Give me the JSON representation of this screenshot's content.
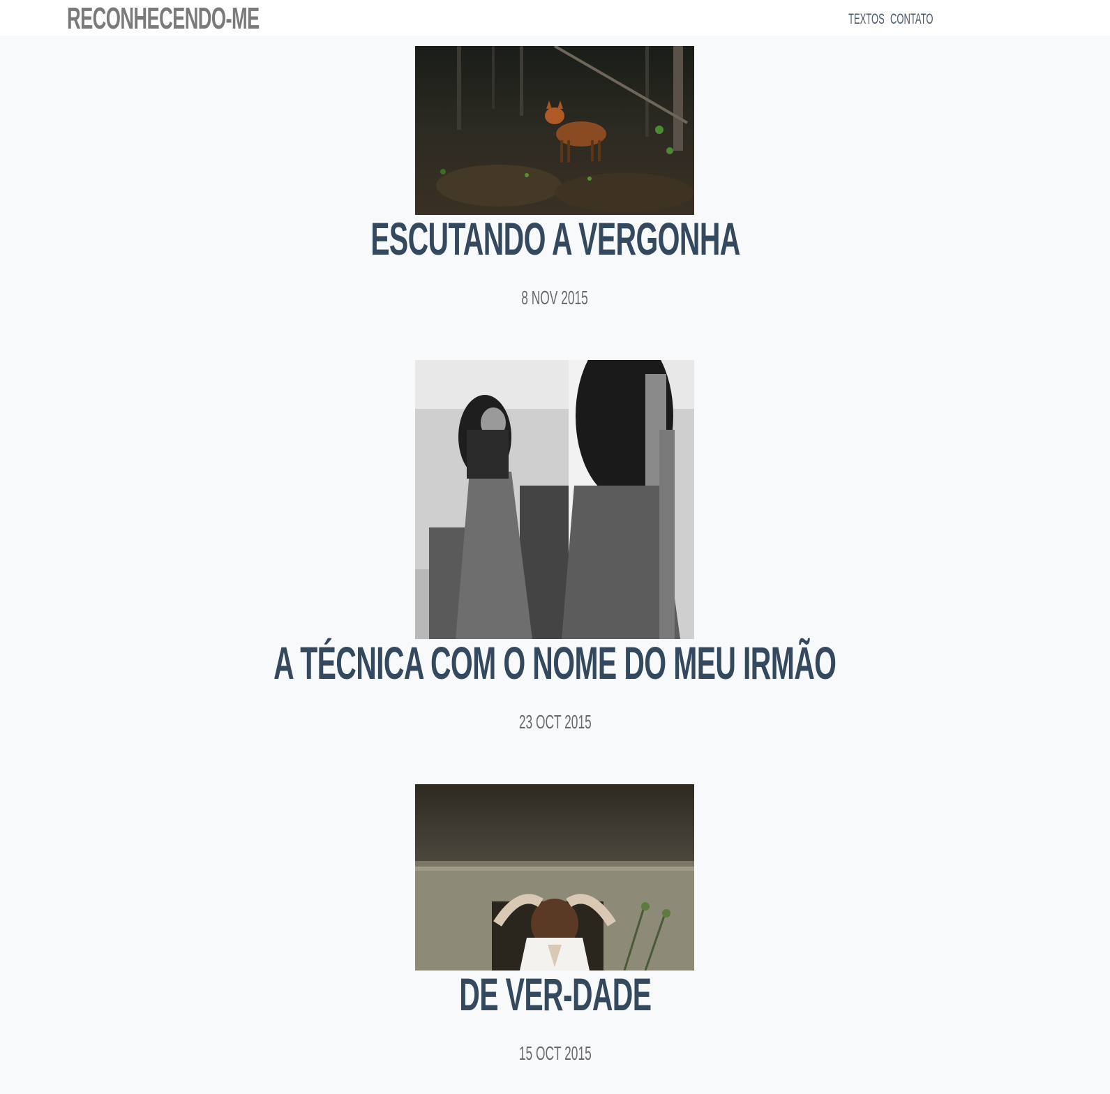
{
  "header": {
    "site_title": "RECONHECENDO-ME",
    "nav": [
      {
        "label": "TEXTOS"
      },
      {
        "label": "CONTATO"
      }
    ]
  },
  "posts": [
    {
      "title": "ESCUTANDO A VERGONHA",
      "date": "8 NOV 2015",
      "image": "fox-in-forest-photo"
    },
    {
      "title": "A TÉCNICA COM O NOME DO MEU IRMÃO",
      "date": "23 OCT 2015",
      "image": "woman-mirror-photo"
    },
    {
      "title": "DE VER-DADE",
      "date": "15 OCT 2015",
      "image": "woman-crown-photo"
    }
  ]
}
